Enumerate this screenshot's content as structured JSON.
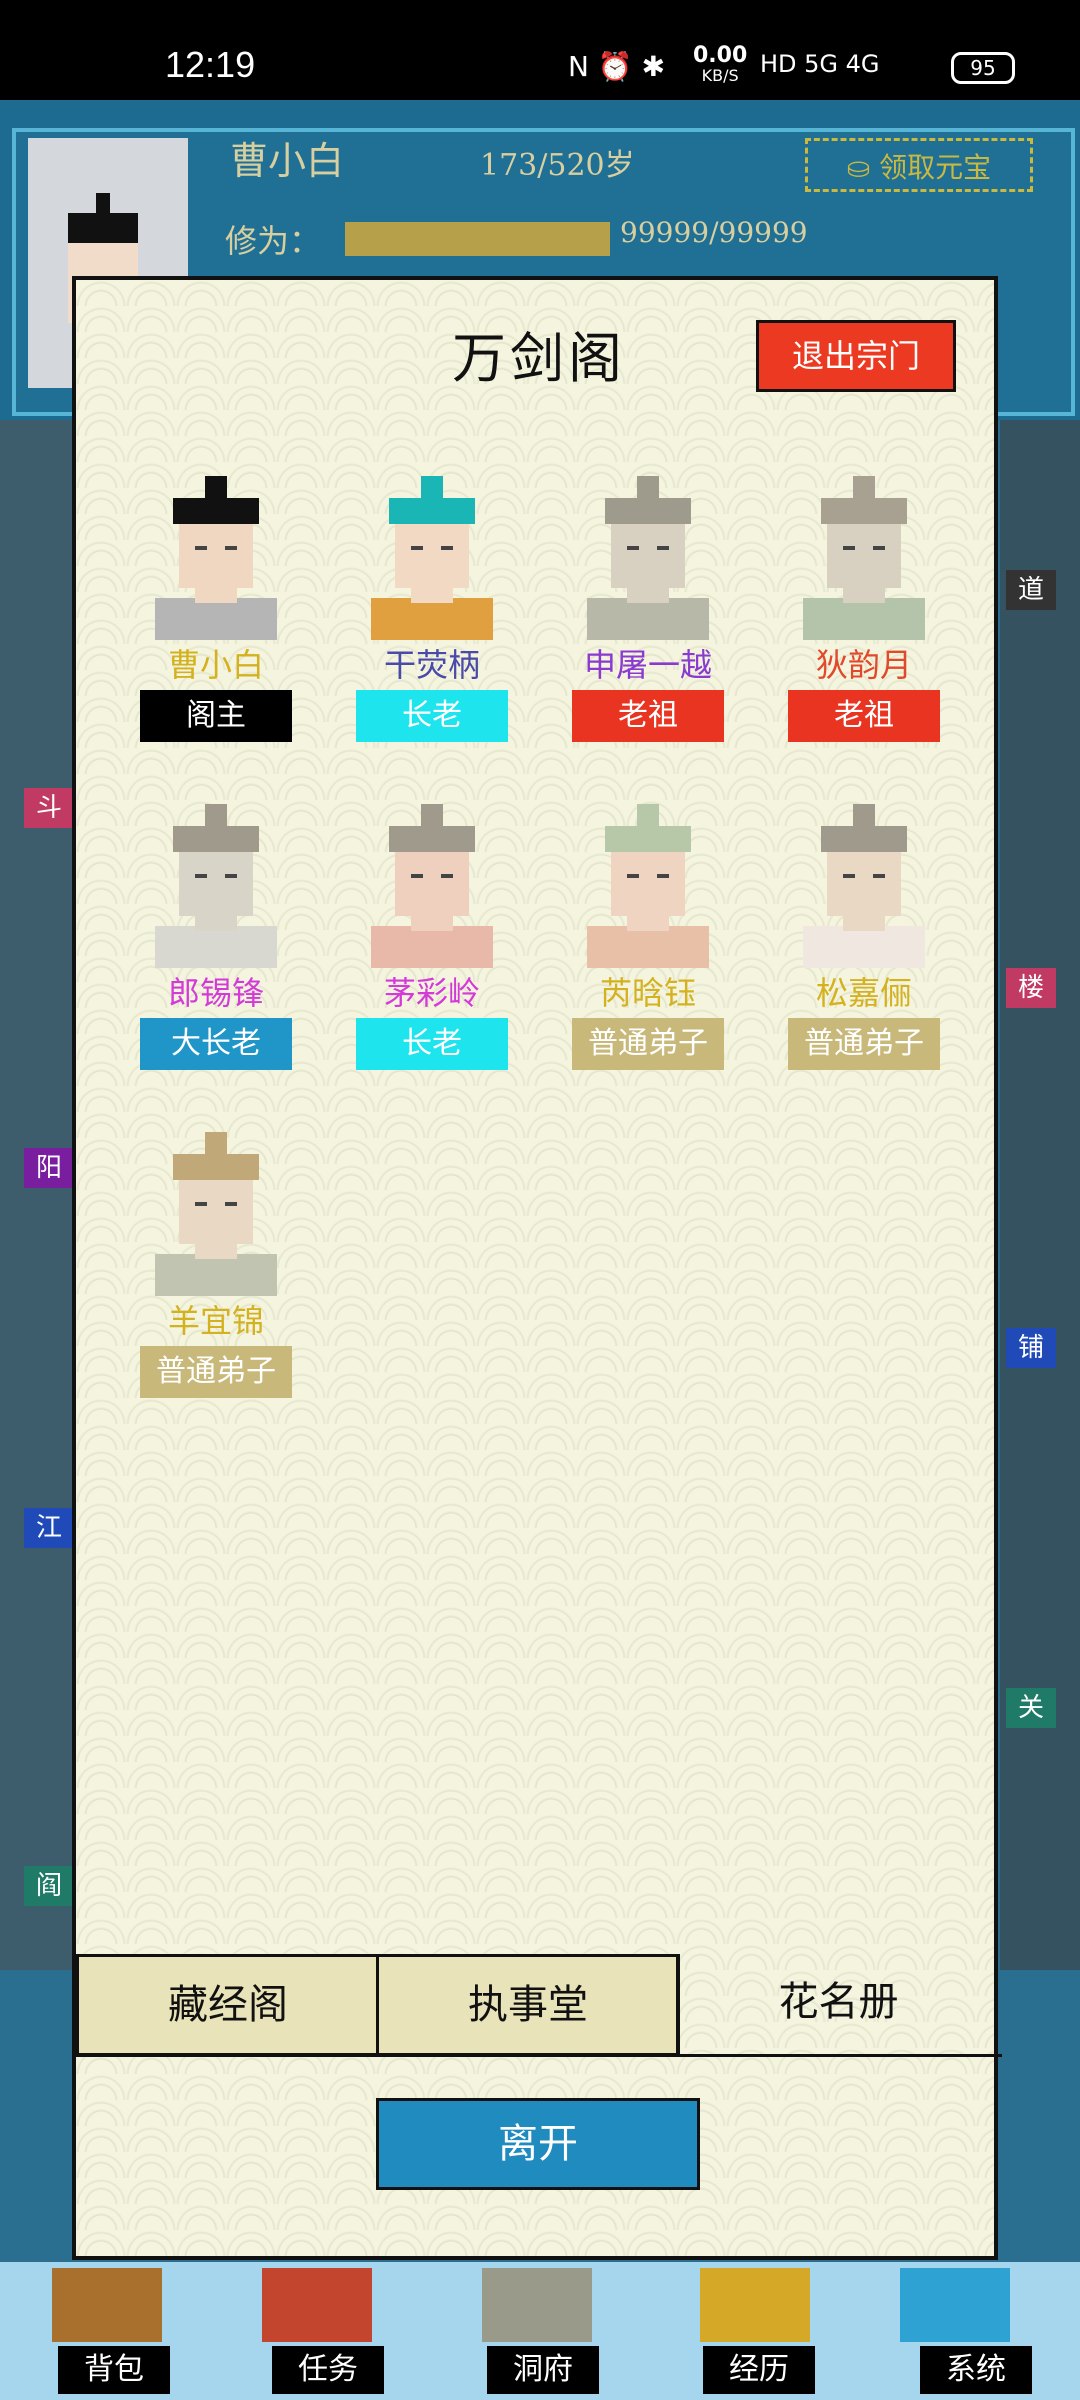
{
  "status_bar": {
    "time": "12:19",
    "net_speed": "0.00",
    "net_unit": "KB/S",
    "icons_text": "N ⏰ ✱",
    "signal": "HD 5G 4G",
    "battery": "95"
  },
  "background": {
    "player_name": "曹小白",
    "age": "173/520岁",
    "gold_button": "领取元宝",
    "cultivation_label": "修为：",
    "cultivation_value": "99999/99999",
    "cultivation_fill": 1.0,
    "side_labels_left": [
      "斗",
      "阳",
      "江",
      "阎"
    ],
    "side_labels_right": [
      "道",
      "楼",
      "铺",
      "关"
    ]
  },
  "modal": {
    "title": "万剑阁",
    "exit_sect_button": "退出宗门",
    "members": [
      {
        "name": "曹小白",
        "rank": "阁主",
        "name_color": "#d4b21f",
        "rank_color": "#000000"
      },
      {
        "name": "干荧柄",
        "rank": "长老",
        "name_color": "#4a4aa8",
        "rank_color": "#1ee4ee"
      },
      {
        "name": "申屠一越",
        "rank": "老祖",
        "name_color": "#8a3ad0",
        "rank_color": "#e93421"
      },
      {
        "name": "狄韵月",
        "rank": "老祖",
        "name_color": "#e04a2a",
        "rank_color": "#e93421"
      },
      {
        "name": "郎锡锋",
        "rank": "大长老",
        "name_color": "#d43ad8",
        "rank_color": "#1f95c8"
      },
      {
        "name": "茅彩岭",
        "rank": "长老",
        "name_color": "#d43ad8",
        "rank_color": "#1ee4ee"
      },
      {
        "name": "芮晗钰",
        "rank": "普通弟子",
        "name_color": "#d4b21f",
        "rank_color": "#c8b87a"
      },
      {
        "name": "松嘉俪",
        "rank": "普通弟子",
        "name_color": "#d4b21f",
        "rank_color": "#c8b87a"
      },
      {
        "name": "羊宜锦",
        "rank": "普通弟子",
        "name_color": "#d4b21f",
        "rank_color": "#c8b87a"
      }
    ],
    "tabs": [
      "藏经阁",
      "执事堂",
      "花名册"
    ],
    "active_tab": "花名册",
    "leave_button": "离开"
  },
  "bottom_nav": [
    "背包",
    "任务",
    "洞府",
    "经历",
    "系统"
  ]
}
